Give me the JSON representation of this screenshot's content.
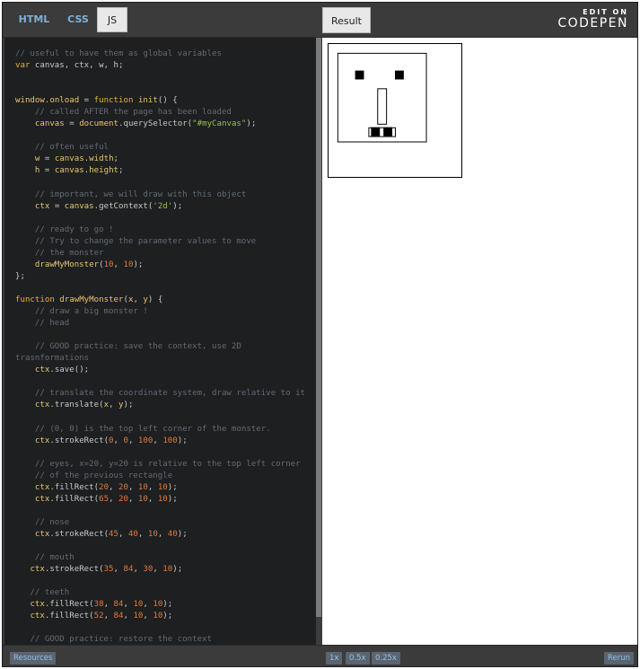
{
  "tabs": [
    {
      "label": "HTML"
    },
    {
      "label": "CSS"
    },
    {
      "label": "JS"
    }
  ],
  "result_tab": {
    "label": "Result"
  },
  "logo": {
    "edit": "EDIT ON",
    "brand": "CODEPEN"
  },
  "code": [
    [
      [
        "cm",
        "// useful to have them as global variables"
      ]
    ],
    [
      [
        "kw",
        "var"
      ],
      [
        "t",
        " canvas, ctx, w, h;"
      ]
    ],
    [],
    [],
    [
      [
        "id",
        "window"
      ],
      [
        "t",
        "."
      ],
      [
        "id",
        "onload"
      ],
      [
        "t",
        " = "
      ],
      [
        "kw",
        "function"
      ],
      [
        "t",
        " "
      ],
      [
        "id",
        "init"
      ],
      [
        "t",
        "() {"
      ]
    ],
    [
      [
        "t",
        "    "
      ],
      [
        "cm",
        "// called AFTER the page has been loaded"
      ]
    ],
    [
      [
        "t",
        "    "
      ],
      [
        "id",
        "canvas"
      ],
      [
        "t",
        " = "
      ],
      [
        "id",
        "document"
      ],
      [
        "t",
        ".querySelector("
      ],
      [
        "str",
        "\"#myCanvas\""
      ],
      [
        "t",
        ");"
      ]
    ],
    [],
    [
      [
        "t",
        "    "
      ],
      [
        "cm",
        "// often useful"
      ]
    ],
    [
      [
        "t",
        "    "
      ],
      [
        "id",
        "w"
      ],
      [
        "t",
        " = "
      ],
      [
        "id",
        "canvas"
      ],
      [
        "t",
        "."
      ],
      [
        "id",
        "width"
      ],
      [
        "t",
        ";"
      ]
    ],
    [
      [
        "t",
        "    "
      ],
      [
        "id",
        "h"
      ],
      [
        "t",
        " = "
      ],
      [
        "id",
        "canvas"
      ],
      [
        "t",
        "."
      ],
      [
        "id",
        "height"
      ],
      [
        "t",
        ";"
      ]
    ],
    [],
    [
      [
        "t",
        "    "
      ],
      [
        "cm",
        "// important, we will draw with this object"
      ]
    ],
    [
      [
        "t",
        "    "
      ],
      [
        "id",
        "ctx"
      ],
      [
        "t",
        " = "
      ],
      [
        "id",
        "canvas"
      ],
      [
        "t",
        ".getContext("
      ],
      [
        "str",
        "'2d'"
      ],
      [
        "t",
        ");"
      ]
    ],
    [],
    [
      [
        "t",
        "    "
      ],
      [
        "cm",
        "// ready to go !"
      ]
    ],
    [
      [
        "t",
        "    "
      ],
      [
        "cm",
        "// Try to change the parameter values to move"
      ]
    ],
    [
      [
        "t",
        "    "
      ],
      [
        "cm",
        "// the monster"
      ]
    ],
    [
      [
        "t",
        "    "
      ],
      [
        "id",
        "drawMyMonster"
      ],
      [
        "t",
        "("
      ],
      [
        "num",
        "10"
      ],
      [
        "t",
        ", "
      ],
      [
        "num",
        "10"
      ],
      [
        "t",
        ");"
      ]
    ],
    [
      [
        "t",
        "};"
      ]
    ],
    [],
    [
      [
        "kw",
        "function"
      ],
      [
        "t",
        " "
      ],
      [
        "id",
        "drawMyMonster"
      ],
      [
        "t",
        "("
      ],
      [
        "id",
        "x"
      ],
      [
        "t",
        ", "
      ],
      [
        "id",
        "y"
      ],
      [
        "t",
        ") {"
      ]
    ],
    [
      [
        "t",
        "    "
      ],
      [
        "cm",
        "// draw a big monster !"
      ]
    ],
    [
      [
        "t",
        "    "
      ],
      [
        "cm",
        "// head"
      ]
    ],
    [],
    [
      [
        "t",
        "    "
      ],
      [
        "cm",
        "// GOOD practice: save the context, use 2D"
      ]
    ],
    [
      [
        "cm",
        "trasnformations"
      ]
    ],
    [
      [
        "t",
        "    "
      ],
      [
        "id",
        "ctx"
      ],
      [
        "t",
        ".save();"
      ]
    ],
    [],
    [
      [
        "t",
        "    "
      ],
      [
        "cm",
        "// translate the coordinate system, draw relative to it"
      ]
    ],
    [
      [
        "t",
        "    "
      ],
      [
        "id",
        "ctx"
      ],
      [
        "t",
        ".translate("
      ],
      [
        "id",
        "x"
      ],
      [
        "t",
        ", "
      ],
      [
        "id",
        "y"
      ],
      [
        "t",
        ");"
      ]
    ],
    [],
    [
      [
        "t",
        "    "
      ],
      [
        "cm",
        "// (0, 0) is the top left corner of the monster."
      ]
    ],
    [
      [
        "t",
        "    "
      ],
      [
        "id",
        "ctx"
      ],
      [
        "t",
        ".strokeRect("
      ],
      [
        "num",
        "0"
      ],
      [
        "t",
        ", "
      ],
      [
        "num",
        "0"
      ],
      [
        "t",
        ", "
      ],
      [
        "num",
        "100"
      ],
      [
        "t",
        ", "
      ],
      [
        "num",
        "100"
      ],
      [
        "t",
        ");"
      ]
    ],
    [],
    [
      [
        "t",
        "    "
      ],
      [
        "cm",
        "// eyes, x=20, y=20 is relative to the top left corner"
      ]
    ],
    [
      [
        "t",
        "    "
      ],
      [
        "cm",
        "// of the previous rectangle"
      ]
    ],
    [
      [
        "t",
        "    "
      ],
      [
        "id",
        "ctx"
      ],
      [
        "t",
        ".fillRect("
      ],
      [
        "num",
        "20"
      ],
      [
        "t",
        ", "
      ],
      [
        "num",
        "20"
      ],
      [
        "t",
        ", "
      ],
      [
        "num",
        "10"
      ],
      [
        "t",
        ", "
      ],
      [
        "num",
        "10"
      ],
      [
        "t",
        ");"
      ]
    ],
    [
      [
        "t",
        "    "
      ],
      [
        "id",
        "ctx"
      ],
      [
        "t",
        ".fillRect("
      ],
      [
        "num",
        "65"
      ],
      [
        "t",
        ", "
      ],
      [
        "num",
        "20"
      ],
      [
        "t",
        ", "
      ],
      [
        "num",
        "10"
      ],
      [
        "t",
        ", "
      ],
      [
        "num",
        "10"
      ],
      [
        "t",
        ");"
      ]
    ],
    [],
    [
      [
        "t",
        "    "
      ],
      [
        "cm",
        "// nose"
      ]
    ],
    [
      [
        "t",
        "    "
      ],
      [
        "id",
        "ctx"
      ],
      [
        "t",
        ".strokeRect("
      ],
      [
        "num",
        "45"
      ],
      [
        "t",
        ", "
      ],
      [
        "num",
        "40"
      ],
      [
        "t",
        ", "
      ],
      [
        "num",
        "10"
      ],
      [
        "t",
        ", "
      ],
      [
        "num",
        "40"
      ],
      [
        "t",
        ");"
      ]
    ],
    [],
    [
      [
        "t",
        "    "
      ],
      [
        "cm",
        "// mouth"
      ]
    ],
    [
      [
        "t",
        "   "
      ],
      [
        "id",
        "ctx"
      ],
      [
        "t",
        ".strokeRect("
      ],
      [
        "num",
        "35"
      ],
      [
        "t",
        ", "
      ],
      [
        "num",
        "84"
      ],
      [
        "t",
        ", "
      ],
      [
        "num",
        "30"
      ],
      [
        "t",
        ", "
      ],
      [
        "num",
        "10"
      ],
      [
        "t",
        ");"
      ]
    ],
    [],
    [
      [
        "t",
        "   "
      ],
      [
        "cm",
        "// teeth"
      ]
    ],
    [
      [
        "t",
        "   "
      ],
      [
        "id",
        "ctx"
      ],
      [
        "t",
        ".fillRect("
      ],
      [
        "num",
        "38"
      ],
      [
        "t",
        ", "
      ],
      [
        "num",
        "84"
      ],
      [
        "t",
        ", "
      ],
      [
        "num",
        "10"
      ],
      [
        "t",
        ", "
      ],
      [
        "num",
        "10"
      ],
      [
        "t",
        ");"
      ]
    ],
    [
      [
        "t",
        "   "
      ],
      [
        "id",
        "ctx"
      ],
      [
        "t",
        ".fillRect("
      ],
      [
        "num",
        "52"
      ],
      [
        "t",
        ", "
      ],
      [
        "num",
        "84"
      ],
      [
        "t",
        ", "
      ],
      [
        "num",
        "10"
      ],
      [
        "t",
        ", "
      ],
      [
        "num",
        "10"
      ],
      [
        "t",
        ");"
      ]
    ],
    [],
    [
      [
        "t",
        "   "
      ],
      [
        "cm",
        "// GOOD practice: restore the context"
      ]
    ]
  ],
  "monster": {
    "head": [
      0,
      0,
      100,
      100
    ],
    "eyes": [
      [
        20,
        20,
        10,
        10
      ],
      [
        65,
        20,
        10,
        10
      ]
    ],
    "nose": [
      45,
      40,
      10,
      40
    ],
    "mouth": [
      35,
      84,
      30,
      10
    ],
    "teeth": [
      [
        38,
        84,
        10,
        10
      ],
      [
        52,
        84,
        10,
        10
      ]
    ],
    "offset": [
      10,
      10
    ]
  },
  "bottombar": {
    "resources": "Resources",
    "zoom": [
      "1x",
      "0.5x",
      "0.25x"
    ],
    "rerun": "Rerun"
  }
}
